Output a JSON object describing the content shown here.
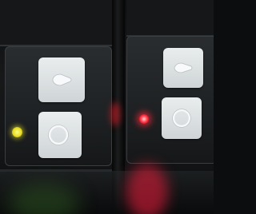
{
  "scene": {
    "description_items": [
      "two-panel-device",
      "play-button",
      "circle-button",
      "indicator-leds"
    ],
    "colors": {
      "led_left": "#e8de24",
      "led_right": "#ff2a3a",
      "button_face": "#e2e6e8",
      "panel": "#1f2224"
    },
    "icons": {
      "top_buttons": "play-triangle-icon",
      "bottom_buttons": "circle-icon"
    }
  }
}
